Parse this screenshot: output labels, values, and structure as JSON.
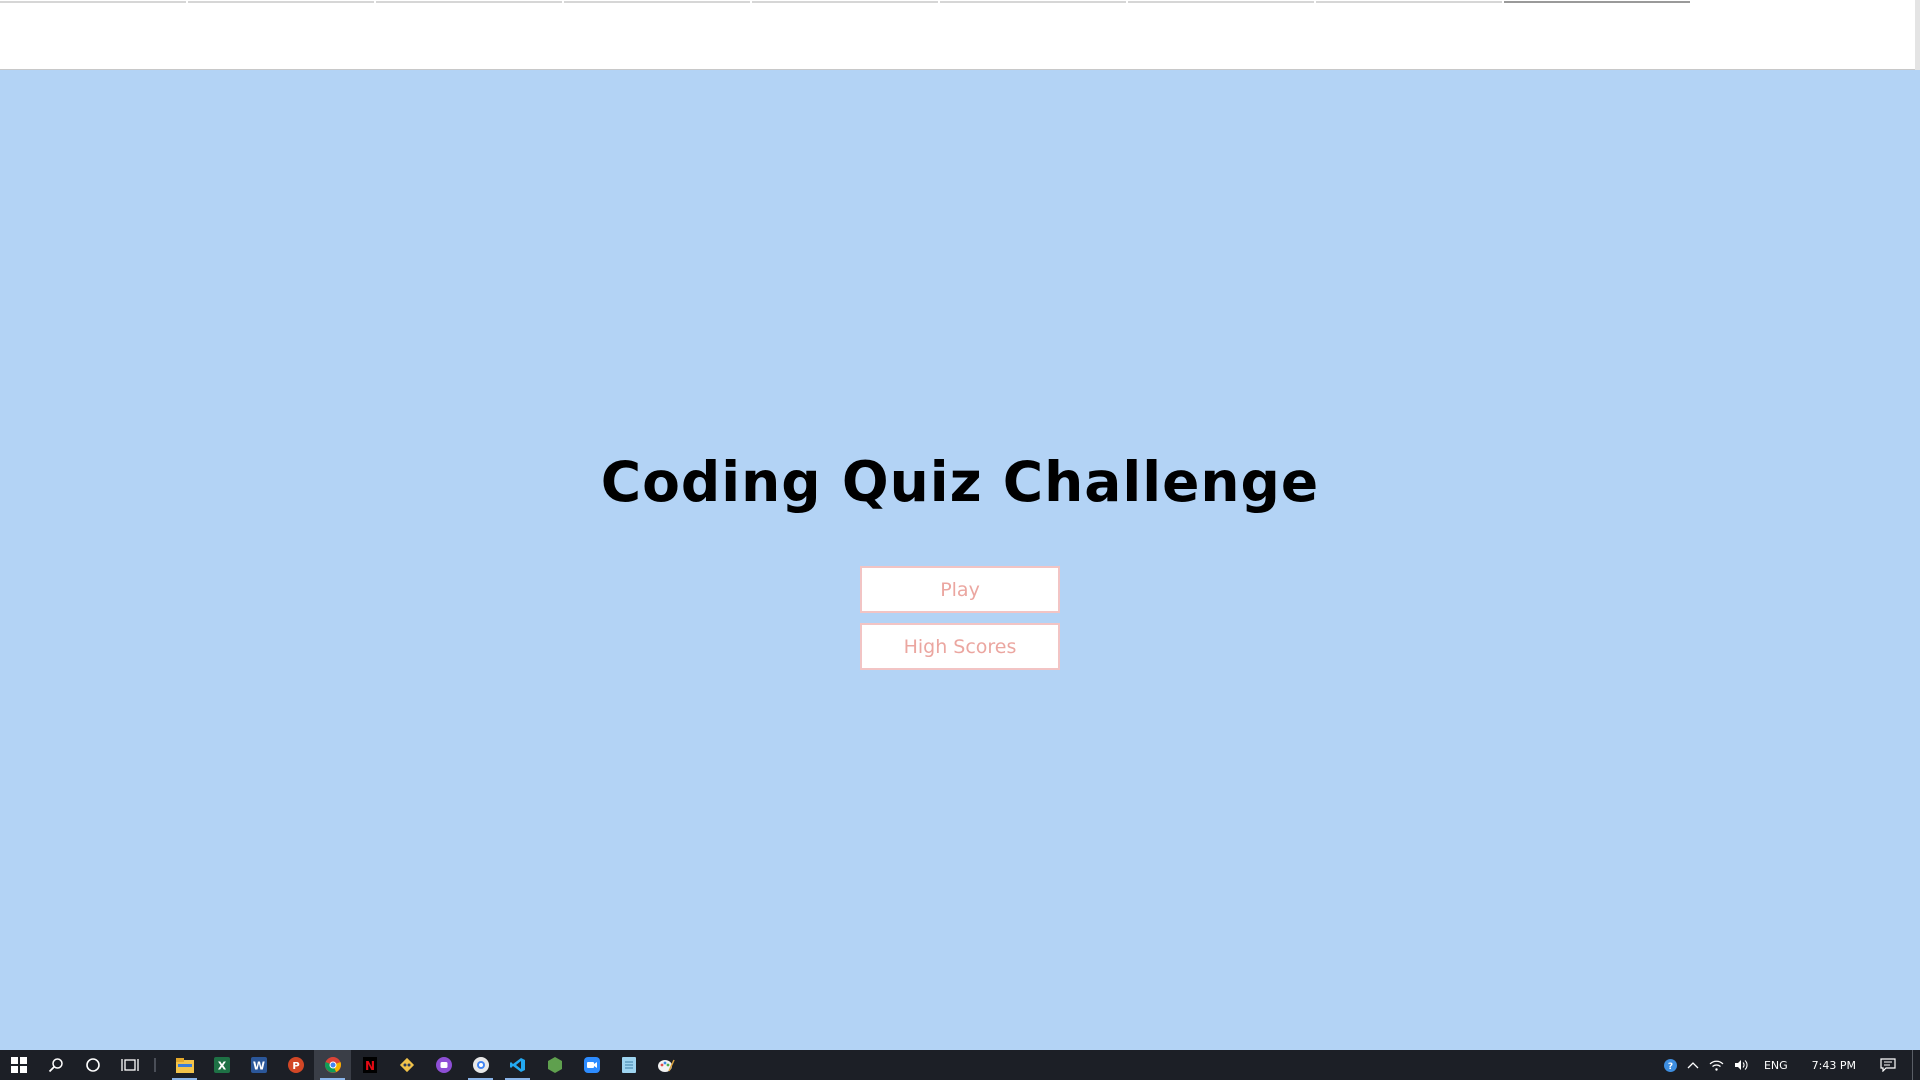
{
  "page": {
    "background": "#b3d3f5",
    "title": "Coding Quiz Challenge",
    "buttons": {
      "play_label": "Play",
      "high_scores_label": "High Scores",
      "text_color": "#eba6a0",
      "border_color": "#f2c4c4"
    }
  },
  "taskbar": {
    "apps": [
      {
        "name": "start-icon"
      },
      {
        "name": "search-icon"
      },
      {
        "name": "cortana-icon"
      },
      {
        "name": "task-view-icon"
      },
      {
        "name": "file-explorer-icon"
      },
      {
        "name": "excel-icon"
      },
      {
        "name": "word-icon"
      },
      {
        "name": "powerpoint-icon"
      },
      {
        "name": "chrome-icon"
      },
      {
        "name": "netflix-icon"
      },
      {
        "name": "git-icon"
      },
      {
        "name": "discord-like-icon"
      },
      {
        "name": "chrome-alt-icon"
      },
      {
        "name": "vscode-icon"
      },
      {
        "name": "node-icon"
      },
      {
        "name": "zoom-icon"
      },
      {
        "name": "notepad-icon"
      },
      {
        "name": "paint-icon"
      }
    ],
    "tray": {
      "language": "ENG",
      "time": "7:43 PM"
    }
  }
}
